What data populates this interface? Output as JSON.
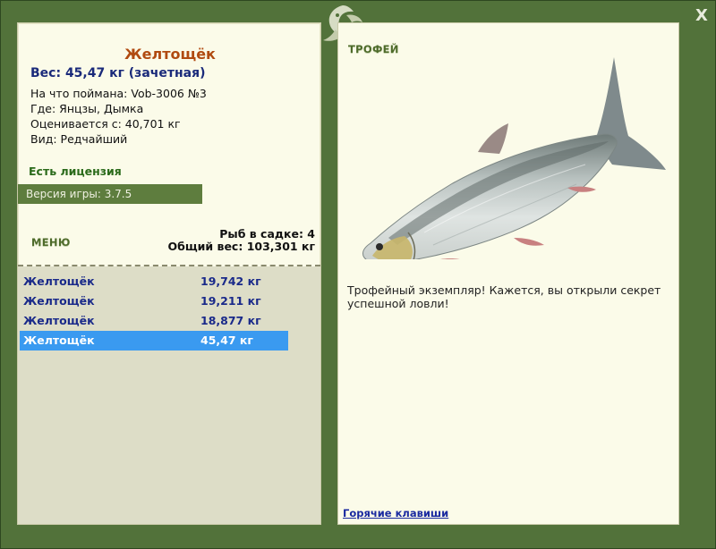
{
  "window": {
    "close_label": "X"
  },
  "fish": {
    "name": "Желтощёк",
    "weight_line": "Вес: 45,47 кг (зачетная)",
    "caught_on": "На что поймана: Vob-3006 №3",
    "location": "Где: Янцзы, Дымка",
    "valued_from": "Оценивается с: 40,701 кг",
    "rarity": "Вид: Редчайший"
  },
  "license": "Есть лицензия",
  "version": "Версия игры: 3.7.5",
  "menu_label": "МЕНЮ",
  "keepnet": {
    "count_line": "Рыб в садке: 4",
    "total_line": "Общий вес: 103,301 кг"
  },
  "catch_list": [
    {
      "name": "Желтощёк",
      "weight": "19,742 кг"
    },
    {
      "name": "Желтощёк",
      "weight": "19,211 кг"
    },
    {
      "name": "Желтощёк",
      "weight": "18,877 кг"
    },
    {
      "name": "Желтощёк",
      "weight": "45,47 кг",
      "selected": true
    }
  ],
  "trophy": {
    "label": "ТРОФЕЙ",
    "text": "Трофейный экземпляр! Кажется, вы открыли секрет успешной ловли!"
  },
  "hotkeys_link": "Горячие клавиши",
  "colors": {
    "frame": "#52723a",
    "panel": "#fbfbe9",
    "name_accent": "#b04a10",
    "weight_text": "#1a2a7a",
    "selected_row": "#3a9af0"
  },
  "icons": {
    "emblem": "fish-emblem-icon",
    "close": "close-icon"
  }
}
